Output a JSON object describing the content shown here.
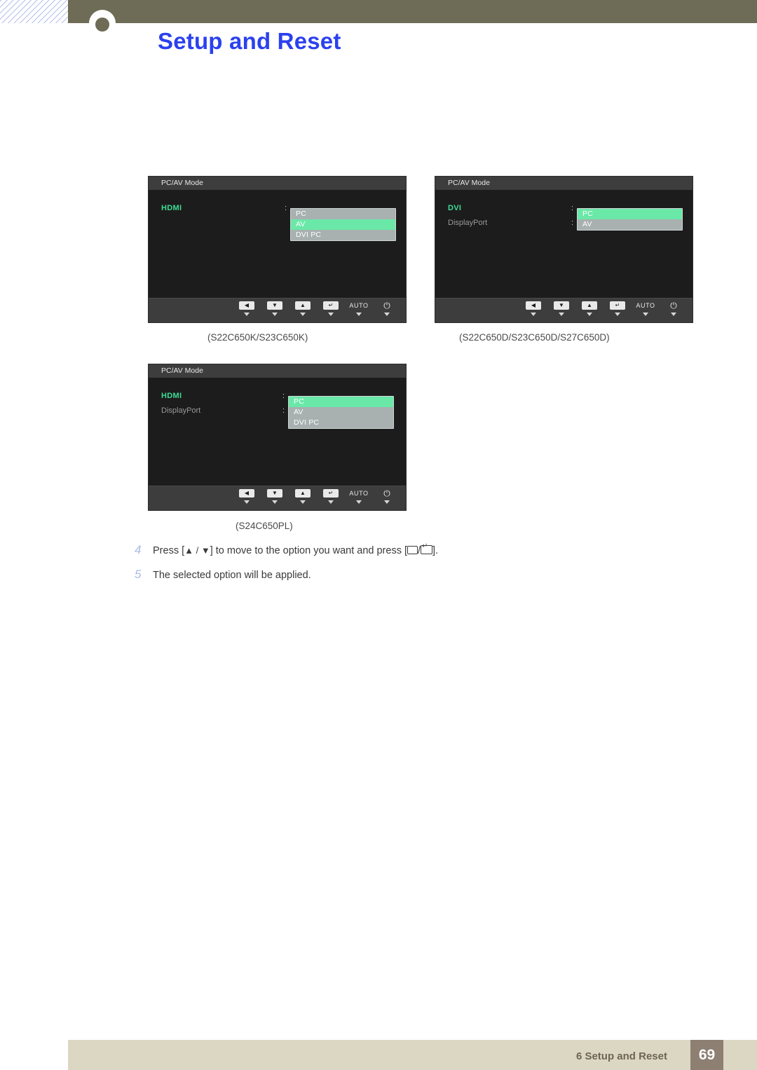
{
  "header": {
    "title": "Setup and Reset",
    "title_color": "#2b41ee",
    "band_color": "#6e6c56"
  },
  "osd_panels": [
    {
      "id": "panel-1",
      "title": "PC/AV Mode",
      "rows": [
        {
          "label": "HDMI",
          "state": "active",
          "colon": ":"
        }
      ],
      "options": [
        {
          "label": "PC",
          "selected": false
        },
        {
          "label": "AV",
          "selected": true
        },
        {
          "label": "DVI PC",
          "selected": false
        }
      ],
      "caption": "(S22C650K/S23C650K)"
    },
    {
      "id": "panel-2",
      "title": "PC/AV Mode",
      "rows": [
        {
          "label": "DVI",
          "state": "active",
          "colon": ":"
        },
        {
          "label": "DisplayPort",
          "state": "dim",
          "colon": ":"
        }
      ],
      "options": [
        {
          "label": "PC",
          "selected": true
        },
        {
          "label": "AV",
          "selected": false
        }
      ],
      "caption": "(S22C650D/S23C650D/S27C650D)"
    },
    {
      "id": "panel-3",
      "title": "PC/AV Mode",
      "rows": [
        {
          "label": "HDMI",
          "state": "active",
          "colon": ":"
        },
        {
          "label": "DisplayPort",
          "state": "dim",
          "colon": ":"
        }
      ],
      "options": [
        {
          "label": "PC",
          "selected": true
        },
        {
          "label": "AV",
          "selected": false
        },
        {
          "label": "DVI PC",
          "selected": false
        }
      ],
      "caption": "(S24C650PL)"
    }
  ],
  "osd_buttons": [
    {
      "icon": "left-arrow-icon",
      "glyph": "◀",
      "kind": "key"
    },
    {
      "icon": "down-arrow-icon",
      "glyph": "▼",
      "kind": "key"
    },
    {
      "icon": "up-arrow-icon",
      "glyph": "▲",
      "kind": "key"
    },
    {
      "icon": "enter-icon",
      "glyph": "↵",
      "kind": "key"
    },
    {
      "icon": "auto-label",
      "glyph": "AUTO",
      "kind": "text"
    },
    {
      "icon": "power-icon",
      "glyph": "⏻",
      "kind": "power"
    }
  ],
  "steps": [
    {
      "num": "4",
      "pre": "Press [",
      "keys_1": "▲ / ▼",
      "mid": "] to move to the option you want and press [",
      "post": "]."
    },
    {
      "num": "5",
      "text": "The selected option will be applied."
    }
  ],
  "footer": {
    "text": "6 Setup and Reset",
    "page": "69",
    "band_color": "#dcd7c3",
    "page_box_color": "#8d8073"
  }
}
